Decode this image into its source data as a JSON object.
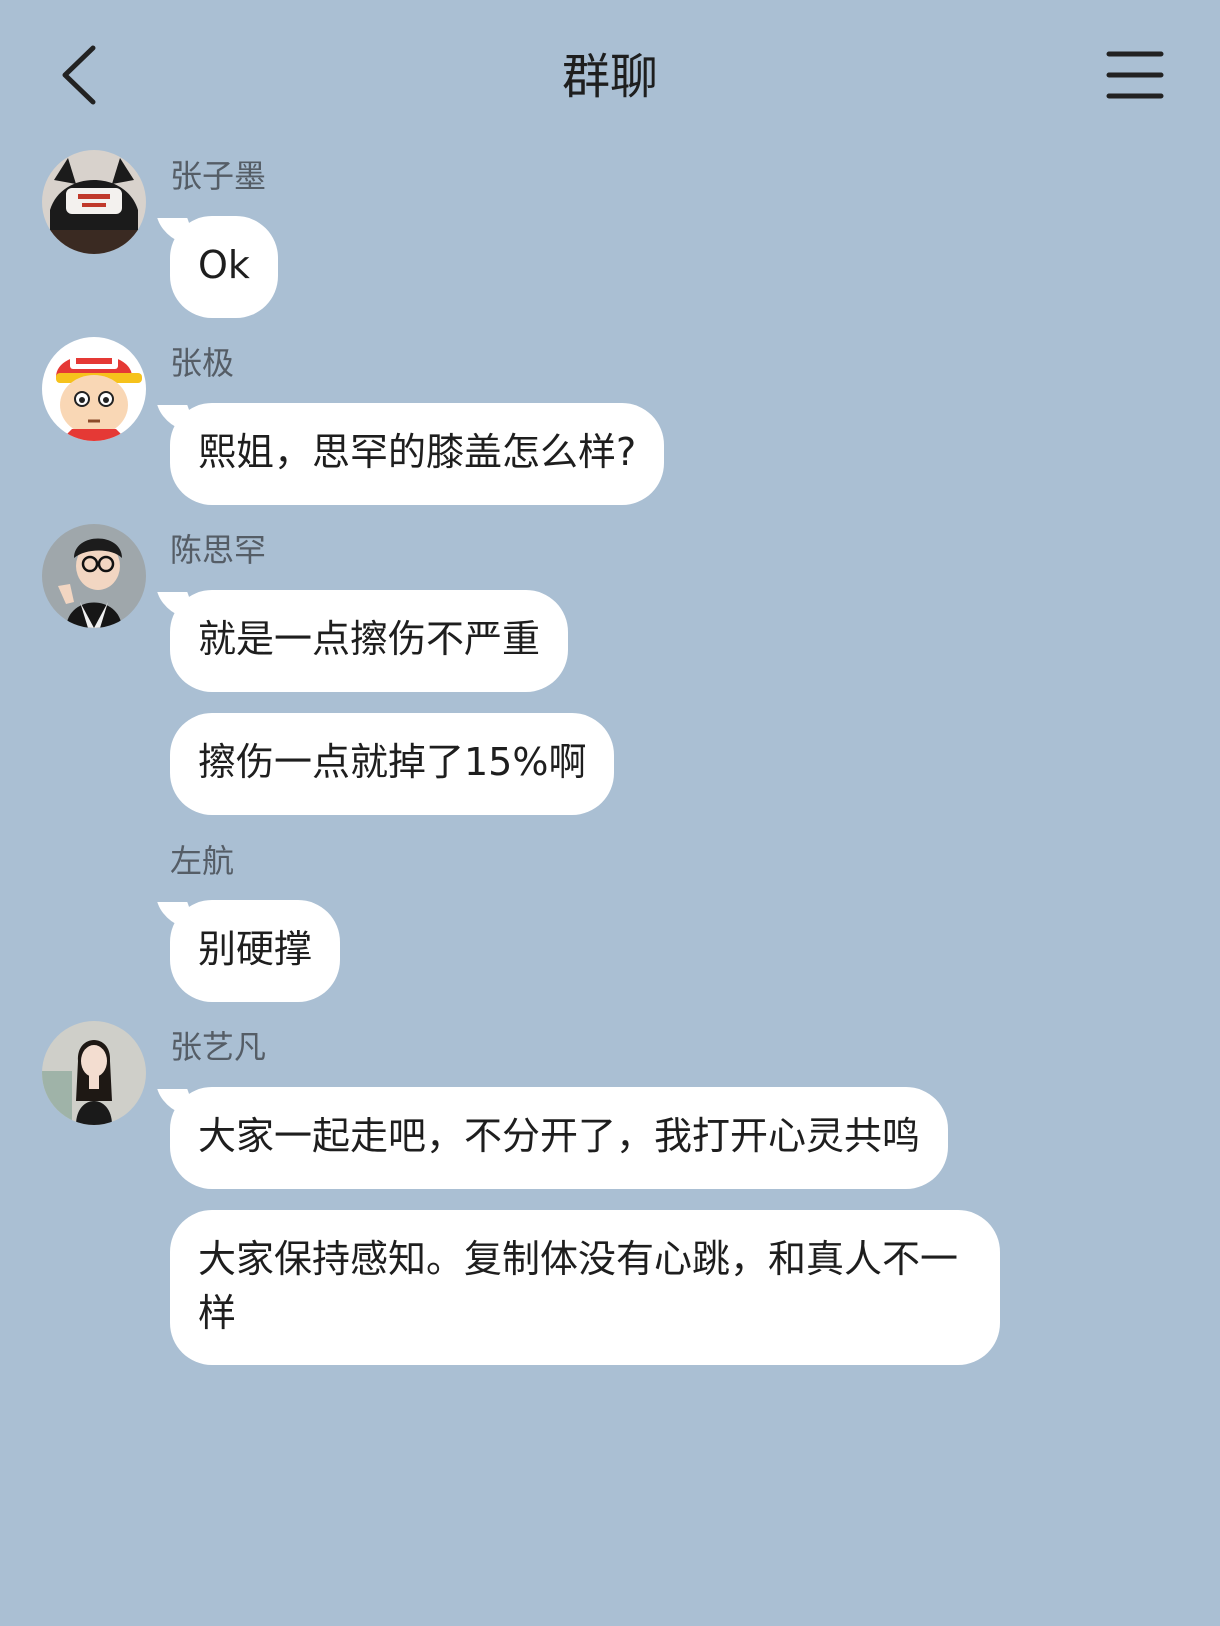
{
  "header": {
    "title": "群聊",
    "back_icon": "chevron-left-icon",
    "menu_icon": "hamburger-menu-icon"
  },
  "messages": [
    {
      "sender": "张子墨",
      "text": "Ok"
    },
    {
      "sender": "张极",
      "text": "熙姐，思罕的膝盖怎么样?"
    },
    {
      "sender": "陈思罕",
      "text": "就是一点擦伤不严重"
    },
    {
      "sender": "",
      "text": "擦伤一点就掉了15%啊"
    },
    {
      "sender": "左航",
      "text": "别硬撑"
    },
    {
      "sender": "张艺凡",
      "text": "大家一起走吧，不分开了，我打开心灵共鸣"
    },
    {
      "sender": "",
      "text": "大家保持感知。复制体没有心跳，和真人不一样"
    }
  ],
  "colors": {
    "background": "#aabfd3",
    "bubble": "#ffffff",
    "name": "#555d66"
  }
}
